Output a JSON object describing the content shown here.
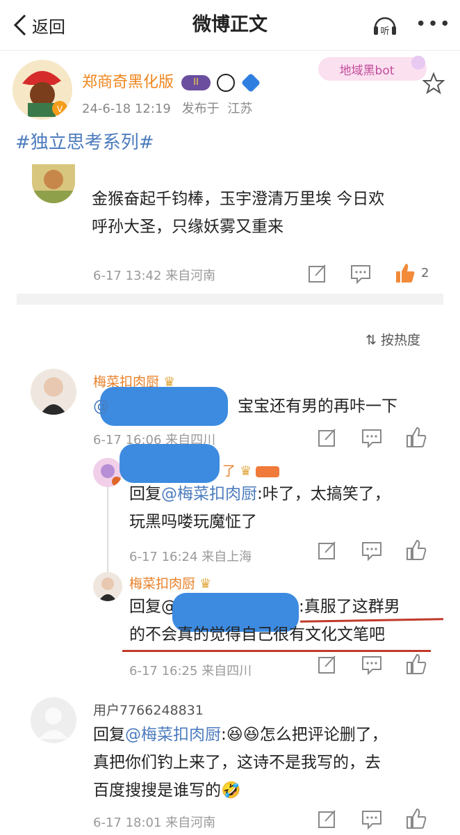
{
  "header": {
    "back_label": "返回",
    "title": "微博正文",
    "listen_label": "听"
  },
  "watermark_text": "地域黑bot",
  "post": {
    "author": "郑商奇黑化版",
    "badge_level": "II",
    "time": "24-6-18 12:19",
    "published_prefix": "发布于",
    "location": "江苏",
    "hashtag": "#独立思考系列#"
  },
  "quoted_comment": {
    "text_line1": "金猴奋起千钧棒，玉宇澄清万里埃 今日欢",
    "text_line2": "呼孙大圣，只缘妖雾又重来",
    "meta": "6-17 13:42  来自河南",
    "like_count": "2"
  },
  "sort_label": "按热度",
  "comments": [
    {
      "name": "梅菜扣肉厨",
      "text_suffix": "宝宝还有男的再咔一下",
      "mention_prefix": "@",
      "meta": "6-17 16:06  来自四川"
    },
    {
      "name_suffix": "了",
      "reply_prefix": "回复",
      "reply_mention": "@梅菜扣肉厨",
      "text_line1": ":咔了，太搞笑了，",
      "text_line2": "玩黑吗喽玩魔怔了",
      "meta": "6-17 16:24  来自上海"
    },
    {
      "name": "梅菜扣肉厨",
      "reply_prefix": "回复@",
      "text_line1_suffix": ":真服了这群男",
      "text_line2": "的不会真的觉得自己很有文化文笔吧",
      "meta": "6-17 16:25  来自四川"
    },
    {
      "name": "用户7766248831",
      "reply_prefix": "回复",
      "reply_mention": "@梅菜扣肉厨",
      "text_line1": ":😆😆怎么把评论删了，",
      "text_line2": "真把你们钓上来了，这诗不是我写的，去",
      "text_line3": "百度搜搜是谁写的🤣",
      "meta": "6-17 18:01  来自河南"
    }
  ],
  "colors": {
    "accent_blue": "#4b7bbd",
    "orange_name": "#f0851d",
    "redact_blue": "#3d8be0",
    "underline_red": "#c0392b"
  }
}
